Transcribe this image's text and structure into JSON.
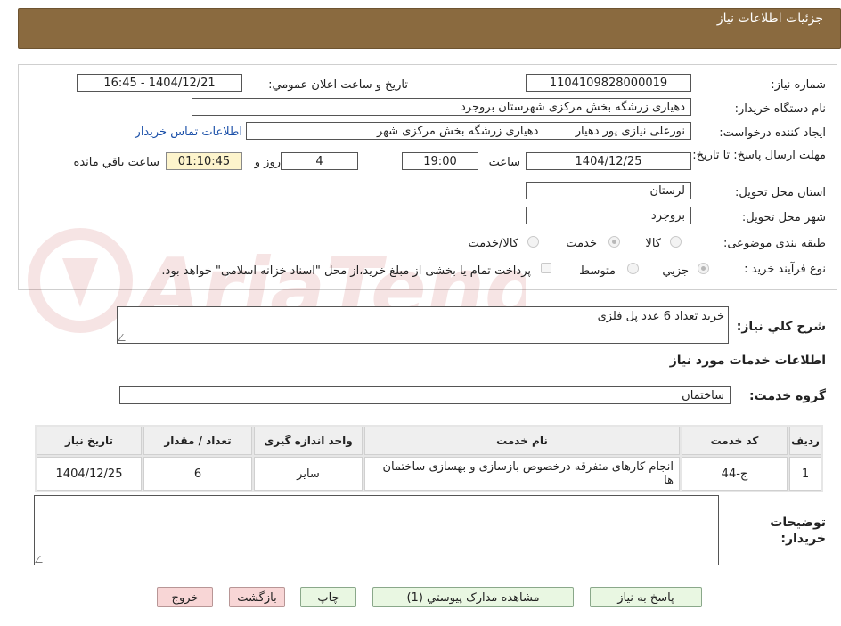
{
  "header": {
    "title": "جزئیات اطلاعات نیاز"
  },
  "fields": {
    "need_number_label": "شماره نیاز:",
    "need_number": "1104109828000019",
    "announce_label": "تاریخ و ساعت اعلان عمومي:",
    "announce_value": "1404/12/21 - 16:45",
    "buyer_org_label": "نام دستگاه خریدار:",
    "buyer_org": "دهیاری زرشگه بخش مرکزی شهرستان بروجرد",
    "requester_label": "ایجاد کننده درخواست:",
    "requester": "نورعلی نیازی پور دهیار          دهیاری زرشگه بخش مرکزی شهر",
    "contact_link": "اطلاعات تماس خریدار",
    "deadline_label": "مهلت ارسال پاسخ: تا تاریخ:",
    "deadline_date": "1404/12/25",
    "time_label": "ساعت",
    "deadline_time": "19:00",
    "days_value": "4",
    "days_label": "روز و",
    "remaining_value": "01:10:45",
    "remaining_label": "ساعت باقي مانده",
    "province_label": "استان محل تحویل:",
    "province": "لرستان",
    "city_label": "شهر محل تحویل:",
    "city": "بروجرد",
    "category_label": "طبقه بندی موضوعی:",
    "category_options": [
      "کالا",
      "خدمت",
      "کالا/خدمت"
    ],
    "category_selected": "خدمت",
    "process_label": "نوع فرآیند خرید :",
    "process_options": [
      "جزيي",
      "متوسط"
    ],
    "process_selected": "جزيي",
    "payment_note": "پرداخت تمام یا بخشی از مبلغ خرید،از محل \"اسناد خزانه اسلامی\" خواهد بود."
  },
  "summary": {
    "label": "شرح کلي نیاز:",
    "value": "خرید تعداد 6 عدد پل فلزی"
  },
  "services": {
    "section_title": "اطلاعات خدمات مورد نیاز",
    "group_label": "گروه خدمت:",
    "group_value": "ساختمان",
    "columns": [
      "ردیف",
      "کد خدمت",
      "نام خدمت",
      "واحد اندازه گیری",
      "تعداد / مقدار",
      "تاریخ نیاز"
    ],
    "rows": [
      {
        "index": "1",
        "code": "ج-44",
        "name": "انجام کارهای متفرقه درخصوص بازسازی و بهسازی ساختمان ها",
        "unit": "سایر",
        "qty": "6",
        "date": "1404/12/25"
      }
    ]
  },
  "buyer_notes": {
    "label": "توضیحات خریدار:",
    "value": ""
  },
  "buttons": {
    "reply": "پاسخ به نیاز",
    "attachments": "مشاهده مدارک پیوستي (1)",
    "print": "چاپ",
    "back": "بازگشت",
    "exit": "خروج"
  },
  "watermark": {
    "text": "AriaTender.neT"
  },
  "colors": {
    "header_bg": "#8a6a3f",
    "link": "#1a4fa8",
    "btn_green": "#e9f7e2",
    "btn_pink": "#f8d6d6"
  }
}
